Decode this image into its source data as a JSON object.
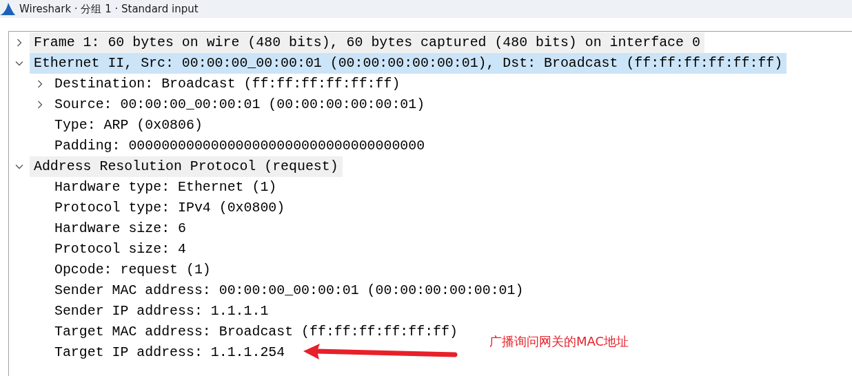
{
  "window": {
    "title": "Wireshark · 分组 1 · Standard input"
  },
  "tree": [
    {
      "label": "Frame 1: 60 bytes on wire (480 bits), 60 bytes captured (480 bits) on interface 0",
      "expanded": false,
      "selected": false
    },
    {
      "label": "Ethernet II, Src: 00:00:00_00:00:01 (00:00:00:00:00:01), Dst: Broadcast (ff:ff:ff:ff:ff:ff)",
      "expanded": true,
      "selected": true,
      "children": [
        {
          "label": "Destination: Broadcast (ff:ff:ff:ff:ff:ff)",
          "expanded": false,
          "selected": false
        },
        {
          "label": "Source: 00:00:00_00:00:01 (00:00:00:00:00:01)",
          "expanded": false,
          "selected": false
        },
        {
          "label": "Type: ARP (0x0806)",
          "selected": false
        },
        {
          "label": "Padding: 000000000000000000000000000000000000",
          "selected": false
        }
      ]
    },
    {
      "label": "Address Resolution Protocol (request)",
      "expanded": true,
      "selected": false,
      "children": [
        {
          "label": "Hardware type: Ethernet (1)",
          "selected": false
        },
        {
          "label": "Protocol type: IPv4 (0x0800)",
          "selected": false
        },
        {
          "label": "Hardware size: 6",
          "selected": false
        },
        {
          "label": "Protocol size: 4",
          "selected": false
        },
        {
          "label": "Opcode: request (1)",
          "selected": false
        },
        {
          "label": "Sender MAC address: 00:00:00_00:00:01 (00:00:00:00:00:01)",
          "selected": false
        },
        {
          "label": "Sender IP address: 1.1.1.1",
          "selected": false
        },
        {
          "label": "Target MAC address: Broadcast (ff:ff:ff:ff:ff:ff)",
          "selected": false
        },
        {
          "label": "Target IP address: 1.1.1.254",
          "selected": false
        }
      ]
    }
  ],
  "annotation": {
    "text": "广播询问网关的MAC地址"
  }
}
